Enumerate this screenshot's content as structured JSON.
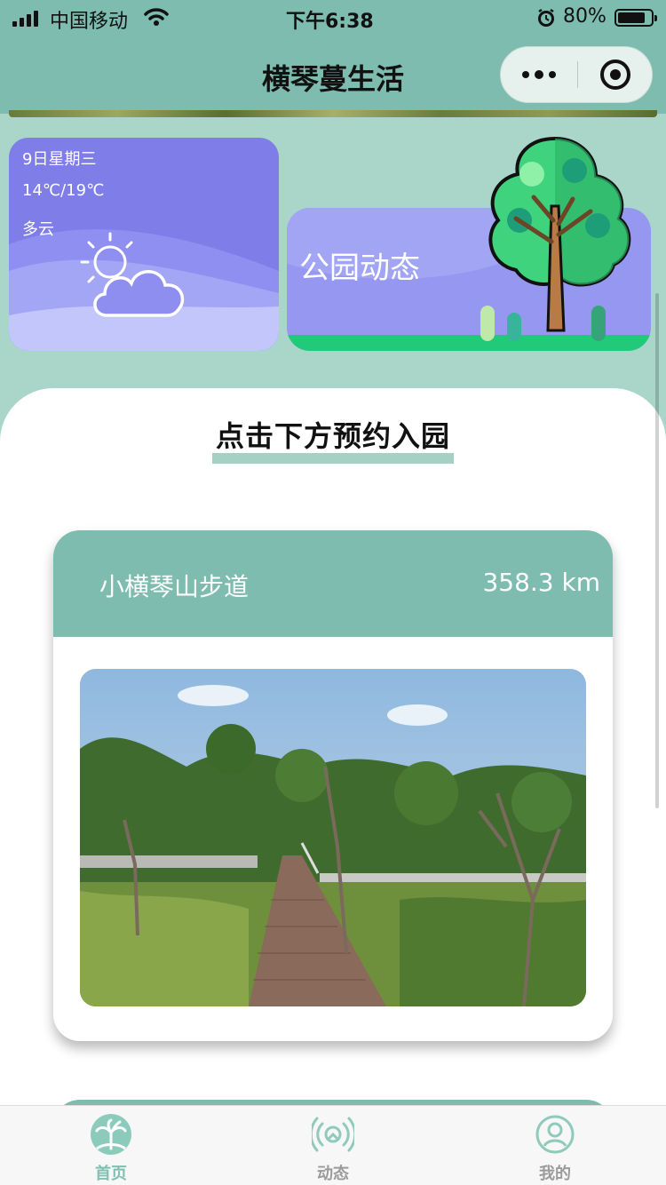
{
  "status_bar": {
    "carrier": "中国移动",
    "time": "下午6:38",
    "battery_percent": "80%"
  },
  "nav": {
    "title": "横琴蔓生活"
  },
  "weather": {
    "date": "9日星期三",
    "temperature": "14℃/19℃",
    "condition": "多云",
    "icon": "partly-cloudy-icon"
  },
  "park_news": {
    "label": "公园动态"
  },
  "reserve": {
    "title": "点击下方预约入园"
  },
  "trails": [
    {
      "name": "小横琴山步道",
      "distance": "358.3 km"
    }
  ],
  "tabbar": {
    "items": [
      {
        "label": "首页",
        "icon": "home-palm-icon",
        "active": true
      },
      {
        "label": "动态",
        "icon": "broadcast-icon",
        "active": false
      },
      {
        "label": "我的",
        "icon": "user-icon",
        "active": false
      }
    ]
  },
  "colors": {
    "primary": "#7dbcae",
    "accent_underline": "#a4d1c3",
    "weather_card": "#7f7de8",
    "park_card": "#9597f0",
    "tab_active": "#7fc0b0"
  }
}
